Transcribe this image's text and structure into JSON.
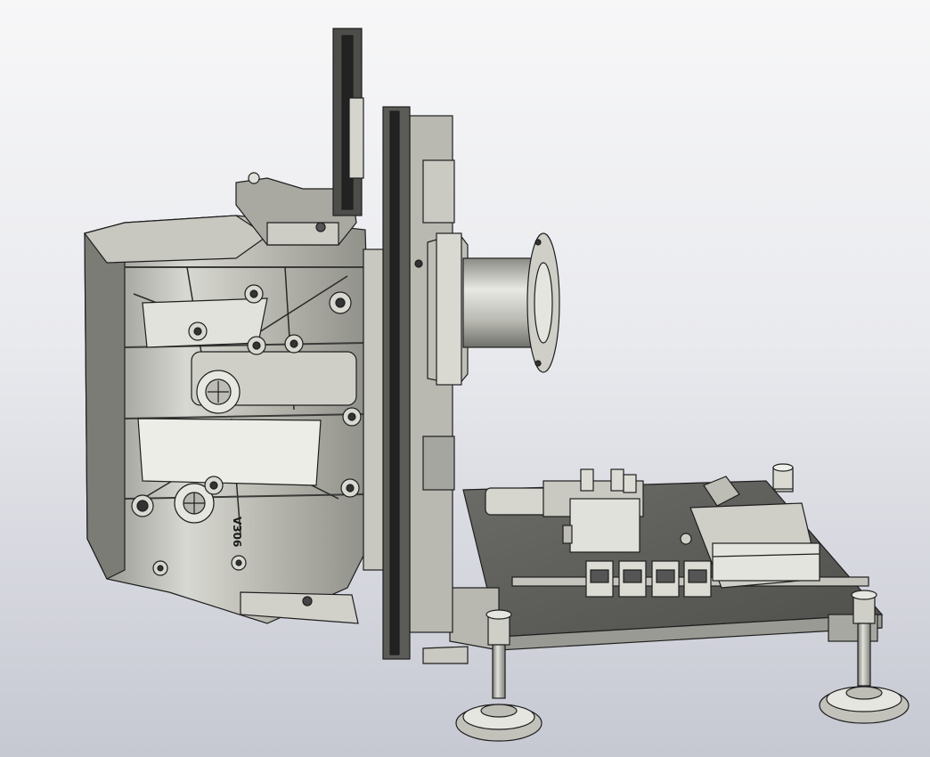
{
  "viewport": {
    "background_top": "#f7f7f8",
    "background_bottom": "#c6c8d2",
    "render_style": "shaded-with-edges"
  },
  "model": {
    "colors": {
      "metal_light": "#e6e6e0",
      "metal_mid": "#b8b8b0",
      "metal_dark": "#6e6e6a",
      "edge": "#1e1e1e",
      "plate": "#5f5f5c"
    },
    "engraved_text": "V306"
  }
}
